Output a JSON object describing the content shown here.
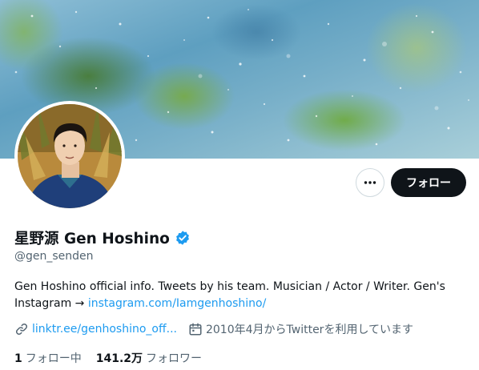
{
  "profile": {
    "display_name": "星野源 Gen Hoshino",
    "handle": "@gen_senden",
    "bio_text": "Gen Hoshino official info. Tweets by his team. Musician / Actor / Writer. Gen's Instagram → ",
    "bio_link": "instagram.com/Iamgenhoshino/",
    "website": "linktr.ee/genhoshino_off...",
    "joined": "2010年4月からTwitterを利用しています",
    "following_count": "1",
    "following_label": "フォロー中",
    "followers_count": "141.2万",
    "followers_label": "フォロワー"
  },
  "actions": {
    "follow_label": "フォロー"
  },
  "icons": {
    "more": "more-horizontal-icon",
    "verified": "verified-badge-icon",
    "link": "link-icon",
    "calendar": "calendar-icon"
  },
  "colors": {
    "accent": "#1d9bf0",
    "text": "#0f1419",
    "muted": "#536471",
    "button_bg": "#0f1419"
  }
}
